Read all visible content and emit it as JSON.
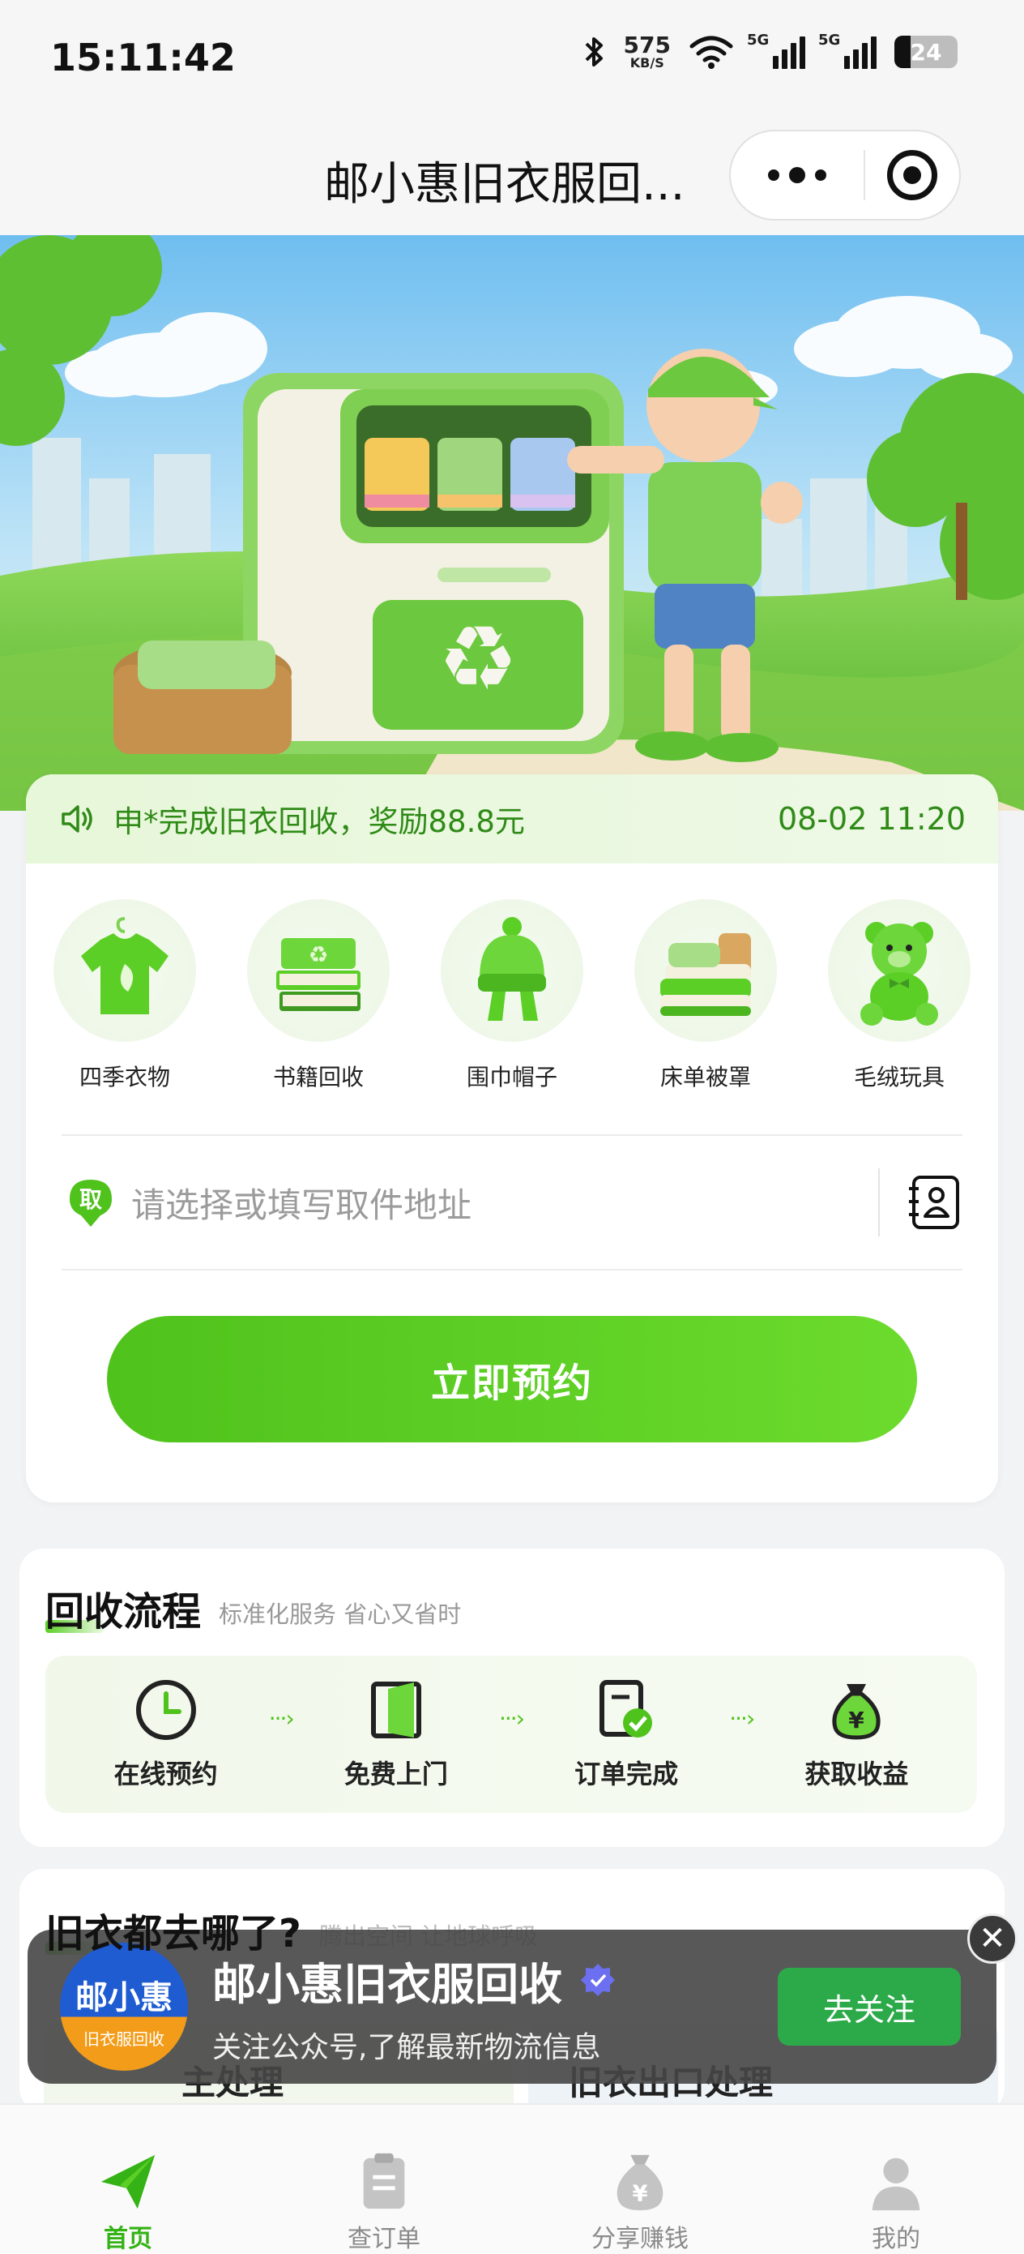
{
  "status_bar": {
    "time": "15:11:42",
    "net_speed_value": "575",
    "net_speed_unit": "KB/S",
    "signal1_label": "5G",
    "signal2_label": "5G",
    "battery": "24"
  },
  "nav": {
    "title": "邮小惠旧衣服回..."
  },
  "notice": {
    "text": "申*完成旧衣回收，奖励88.8元",
    "time": "08-02 11:20"
  },
  "categories": [
    {
      "label": "四季衣物",
      "icon": "tshirt-icon"
    },
    {
      "label": "书籍回收",
      "icon": "books-icon"
    },
    {
      "label": "围巾帽子",
      "icon": "scarf-hat-icon"
    },
    {
      "label": "床单被罩",
      "icon": "bedding-icon"
    },
    {
      "label": "毛绒玩具",
      "icon": "teddy-bear-icon"
    }
  ],
  "address": {
    "pin_label": "取",
    "placeholder": "请选择或填写取件地址"
  },
  "book_button": "立即预约",
  "process": {
    "title": "回收流程",
    "subtitle": "标准化服务 省心又省时",
    "steps": [
      {
        "label": "在线预约",
        "icon": "clock-icon"
      },
      {
        "label": "免费上门",
        "icon": "door-icon"
      },
      {
        "label": "订单完成",
        "icon": "order-done-icon"
      },
      {
        "label": "获取收益",
        "icon": "money-bag-icon"
      }
    ]
  },
  "where": {
    "title": "旧衣都去哪了?",
    "subtitle": "腾出空间 让地球呼吸",
    "card_a": "主处理",
    "card_b": "旧衣出口处理"
  },
  "follow_popup": {
    "logo_main": "邮小惠",
    "logo_sub": "旧衣服回收",
    "name": "邮小惠旧衣服回收",
    "desc": "关注公众号,了解最新物流信息",
    "button": "去关注",
    "close": "✕"
  },
  "tabs": [
    {
      "label": "首页",
      "icon": "home-plane-icon",
      "active": true
    },
    {
      "label": "查订单",
      "icon": "clipboard-icon",
      "active": false
    },
    {
      "label": "分享赚钱",
      "icon": "money-bag-icon",
      "active": false
    },
    {
      "label": "我的",
      "icon": "user-icon",
      "active": false
    }
  ],
  "colors": {
    "brand_green": "#4fc21c",
    "notice_green": "#2f8a17",
    "follow_button": "#2caa4a"
  }
}
